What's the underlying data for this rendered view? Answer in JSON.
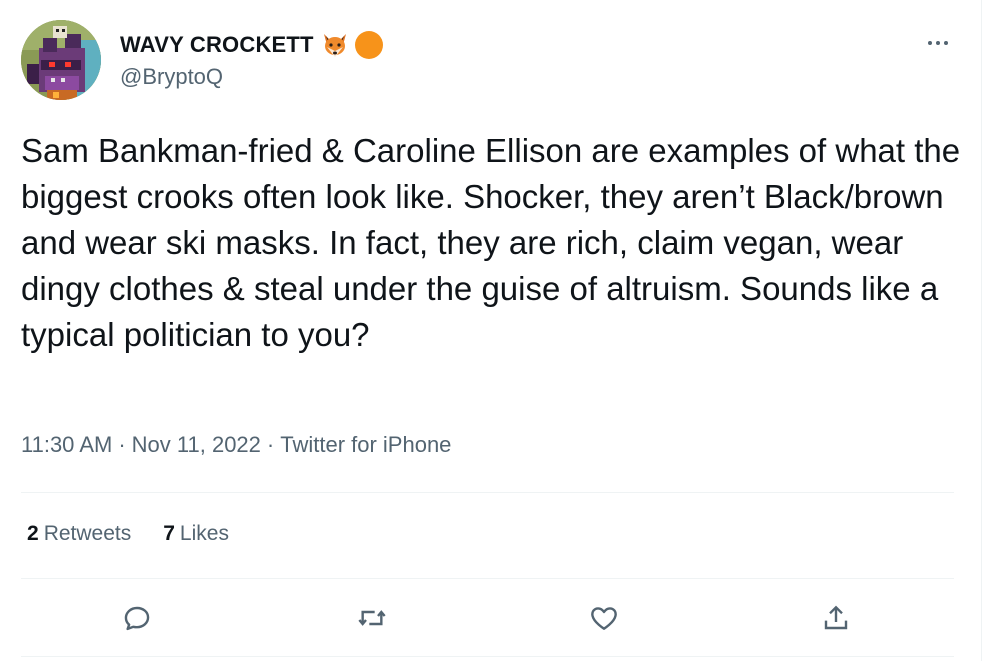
{
  "author": {
    "display_name": "WAVY CROCKETT",
    "handle": "@BryptoQ",
    "avatar_icon": "pixel-dragon-avatar",
    "badges": [
      "fox-emoji",
      "orange-circle"
    ]
  },
  "tweet": {
    "text": "Sam Bankman-fried & Caroline Ellison are examples of what the biggest crooks often look like. Shocker, they aren’t Black/brown and wear ski masks. In fact, they are rich, claim vegan, wear dingy clothes & steal under the guise of altruism. Sounds like a typical politician to you?",
    "time": "11:30 AM",
    "date": "Nov 11, 2022",
    "source": "Twitter for iPhone",
    "separator": "·"
  },
  "stats": {
    "retweets_count": "2",
    "retweets_label": "Retweets",
    "likes_count": "7",
    "likes_label": "Likes"
  },
  "actions": [
    "reply-icon",
    "retweet-icon",
    "like-icon",
    "share-icon"
  ],
  "colors": {
    "text": "#0f1419",
    "secondary": "#536471",
    "divider": "#eff3f4",
    "orange": "#f7931a"
  }
}
